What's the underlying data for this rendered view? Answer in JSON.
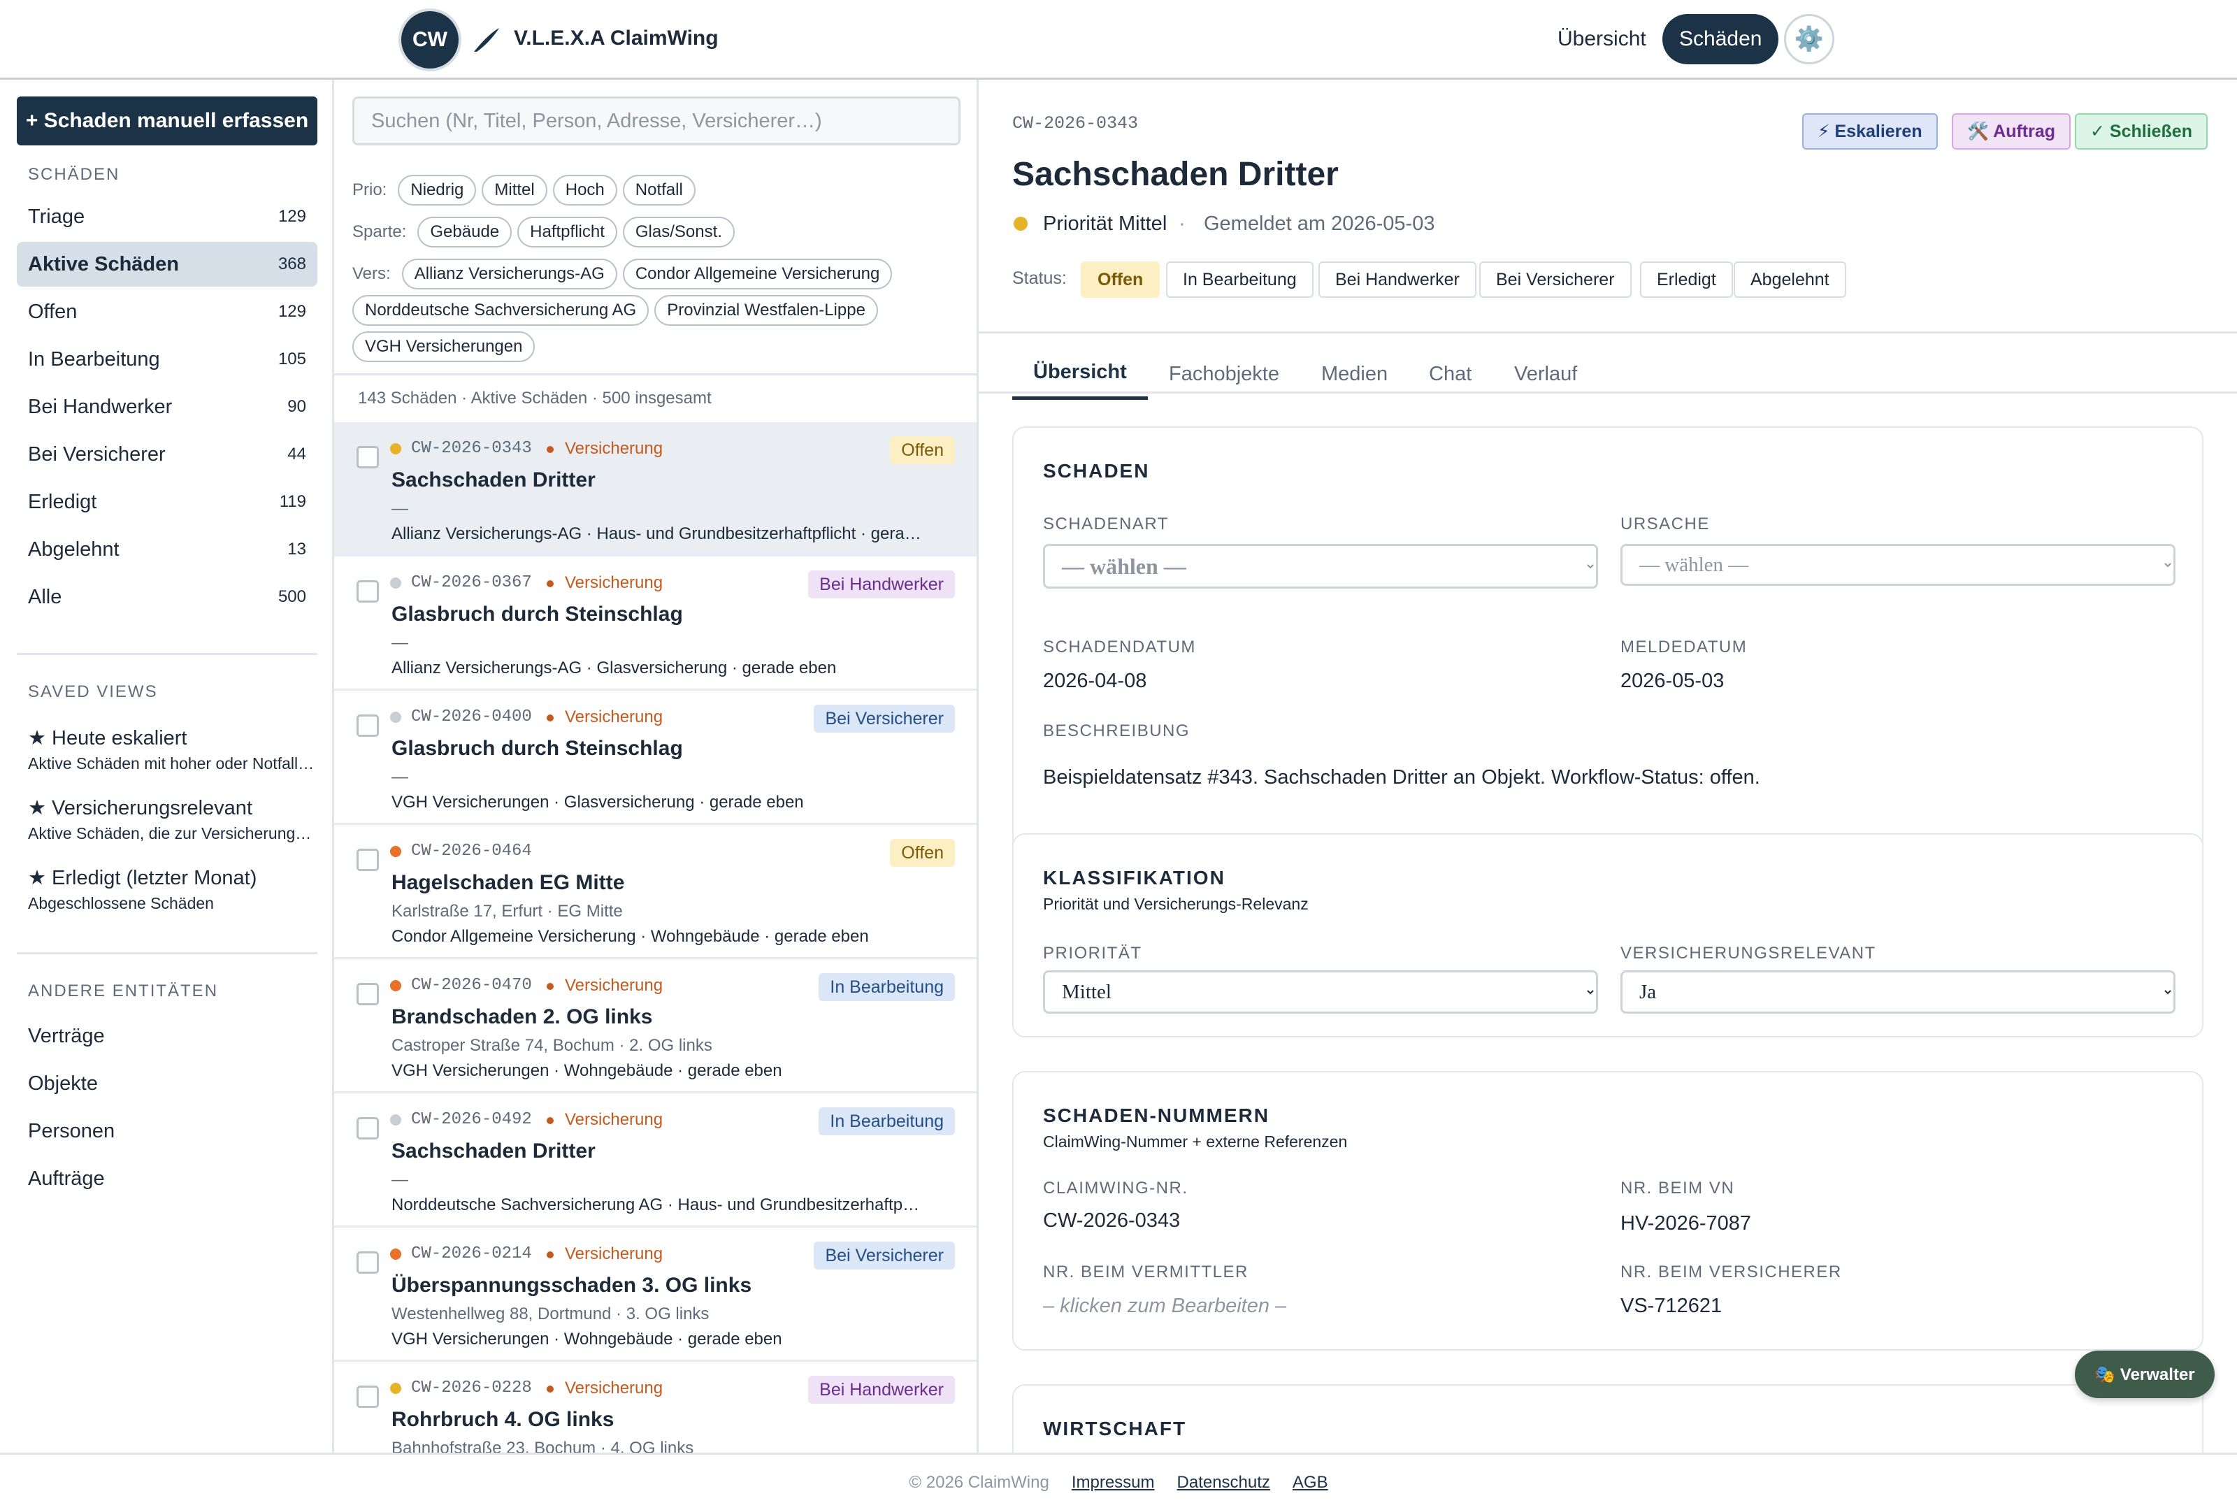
{
  "header": {
    "logo_text": "CW",
    "brand": "V.L.E.X.A ClaimWing",
    "nav": [
      {
        "label": "Übersicht",
        "active": false
      },
      {
        "label": "Schäden",
        "active": true
      }
    ],
    "settings_icon": "gear-icon",
    "settings_glyph": "⚙️"
  },
  "sidebar": {
    "new_button": "+ Schaden manuell erfassen",
    "claims_heading": "Schäden",
    "claims": [
      {
        "label": "Triage",
        "count": "129"
      },
      {
        "label": "Aktive Schäden",
        "count": "368",
        "active": true
      },
      {
        "label": "Offen",
        "count": "129"
      },
      {
        "label": "In Bearbeitung",
        "count": "105"
      },
      {
        "label": "Bei Handwerker",
        "count": "90"
      },
      {
        "label": "Bei Versicherer",
        "count": "44"
      },
      {
        "label": "Erledigt",
        "count": "119"
      },
      {
        "label": "Abgelehnt",
        "count": "13"
      },
      {
        "label": "Alle",
        "count": "500"
      }
    ],
    "views_heading": "Saved Views",
    "views": [
      {
        "title": "★ Heute eskaliert",
        "sub": "Aktive Schäden mit hoher oder Notfall-Priorität"
      },
      {
        "title": "★ Versicherungsrelevant",
        "sub": "Aktive Schäden, die zur Versicherung gemeldet werden"
      },
      {
        "title": "★ Erledigt (letzter Monat)",
        "sub": "Abgeschlossene Schäden"
      }
    ],
    "entities_heading": "Andere Entitäten",
    "entities": [
      "Verträge",
      "Objekte",
      "Personen",
      "Aufträge"
    ]
  },
  "list": {
    "search_placeholder": "Suchen (Nr, Titel, Person, Adresse, Versicherer…)",
    "filters": {
      "prio_label": "Prio:",
      "prio": [
        "Niedrig",
        "Mittel",
        "Hoch",
        "Notfall"
      ],
      "sparte_label": "Sparte:",
      "sparte": [
        "Gebäude",
        "Haftpflicht",
        "Glas/Sonst."
      ],
      "vers_label": "Vers:",
      "vers": [
        "Allianz Versicherungs-AG",
        "Condor Allgemeine Versicherung",
        "Norddeutsche Sachversicherung AG",
        "Provinzial Westfalen-Lippe",
        "VGH Versicherungen"
      ]
    },
    "summary": "143 Schäden · Aktive Schäden · 500 insgesamt",
    "items": [
      {
        "id": "CW-2026-0343",
        "prio_color": "#e7b32a",
        "tag": "Versicherung",
        "status": "Offen",
        "status_class": "st-offen",
        "title": "Sachschaden Dritter",
        "addr": "—",
        "meta": "Allianz Versicherungs-AG · Haus- und Grundbesitzerhaftpflicht · gerade eben",
        "selected": true
      },
      {
        "id": "CW-2026-0367",
        "prio_color": "#c7ced6",
        "tag": "Versicherung",
        "status": "Bei Handwerker",
        "status_class": "st-handwerker",
        "title": "Glasbruch durch Steinschlag",
        "addr": "—",
        "meta": "Allianz Versicherungs-AG · Glasversicherung · gerade eben"
      },
      {
        "id": "CW-2026-0400",
        "prio_color": "#c7ced6",
        "tag": "Versicherung",
        "status": "Bei Versicherer",
        "status_class": "st-versicherer",
        "title": "Glasbruch durch Steinschlag",
        "addr": "—",
        "meta": "VGH Versicherungen · Glasversicherung · gerade eben"
      },
      {
        "id": "CW-2026-0464",
        "prio_color": "#e8702a",
        "tag": "",
        "status": "Offen",
        "status_class": "st-offen",
        "title": "Hagelschaden EG Mitte",
        "addr": "Karlstraße 17, Erfurt · EG Mitte",
        "meta": "Condor Allgemeine Versicherung · Wohngebäude · gerade eben"
      },
      {
        "id": "CW-2026-0470",
        "prio_color": "#e8702a",
        "tag": "Versicherung",
        "status": "In Bearbeitung",
        "status_class": "st-bearbeitung",
        "title": "Brandschaden 2. OG links",
        "addr": "Castroper Straße 74, Bochum · 2. OG links",
        "meta": "VGH Versicherungen · Wohngebäude · gerade eben"
      },
      {
        "id": "CW-2026-0492",
        "prio_color": "#c7ced6",
        "tag": "Versicherung",
        "status": "In Bearbeitung",
        "status_class": "st-bearbeitung",
        "title": "Sachschaden Dritter",
        "addr": "—",
        "meta": "Norddeutsche Sachversicherung AG · Haus- und Grundbesitzerhaftpflicht"
      },
      {
        "id": "CW-2026-0214",
        "prio_color": "#e8702a",
        "tag": "Versicherung",
        "status": "Bei Versicherer",
        "status_class": "st-versicherer",
        "title": "Überspannungsschaden 3. OG links",
        "addr": "Westenhellweg 88, Dortmund · 3. OG links",
        "meta": "VGH Versicherungen · Wohngebäude · gerade eben"
      },
      {
        "id": "CW-2026-0228",
        "prio_color": "#e7b32a",
        "tag": "Versicherung",
        "status": "Bei Handwerker",
        "status_class": "st-handwerker",
        "title": "Rohrbruch 4. OG links",
        "addr": "Bahnhofstraße 23, Bochum · 4. OG links",
        "meta": ""
      }
    ]
  },
  "detail": {
    "id": "CW-2026-0343",
    "actions": {
      "escalate": "⚡ Eskalieren",
      "order": "🛠️ Auftrag",
      "close": "✓ Schließen"
    },
    "title": "Sachschaden Dritter",
    "priority": "Priorität Mittel",
    "separator": "·",
    "reported": "Gemeldet am 2026-05-03",
    "status_label": "Status:",
    "statuses": [
      "Offen",
      "In Bearbeitung",
      "Bei Handwerker",
      "Bei Versicherer",
      "Erledigt",
      "Abgelehnt"
    ],
    "tabs": [
      "Übersicht",
      "Fachobjekte",
      "Medien",
      "Chat",
      "Verlauf"
    ],
    "schaden": {
      "title": "Schaden",
      "art_label": "Schadenart",
      "art_value": "— wählen —",
      "ursache_label": "Ursache",
      "ursache_value": "— wählen —",
      "datum_label": "Schadendatum",
      "datum_value": "2026-04-08",
      "melde_label": "Meldedatum",
      "melde_value": "2026-05-03",
      "beschreibung_label": "Beschreibung",
      "beschreibung_value": "Beispieldatensatz #343. Sachschaden Dritter an Objekt. Workflow-Status: offen."
    },
    "klassifikation": {
      "title": "Klassifikation",
      "sub": "Priorität und Versicherungs-Relevanz",
      "prio_label": "Priorität",
      "prio_value": "Mittel",
      "vers_label": "Versicherungsrelevant",
      "vers_value": "Ja"
    },
    "nummern": {
      "title": "Schaden-Nummern",
      "sub": "ClaimWing-Nummer + externe Referenzen",
      "cw_label": "ClaimWing-Nr.",
      "cw_value": "CW-2026-0343",
      "vn_label": "Nr. beim VN",
      "vn_value": "HV-2026-7087",
      "vermittler_label": "Nr. beim Vermittler",
      "vermittler_value": "– klicken zum Bearbeiten –",
      "versicherer_label": "Nr. beim Versicherer",
      "versicherer_value": "VS-712621"
    },
    "wirtschaft": {
      "title": "Wirtschaft"
    }
  },
  "fab": {
    "label": "🎭 Verwalter"
  },
  "footer": {
    "copyright": "© 2026 ClaimWing",
    "links": [
      "Impressum",
      "Datenschutz",
      "AGB"
    ]
  }
}
